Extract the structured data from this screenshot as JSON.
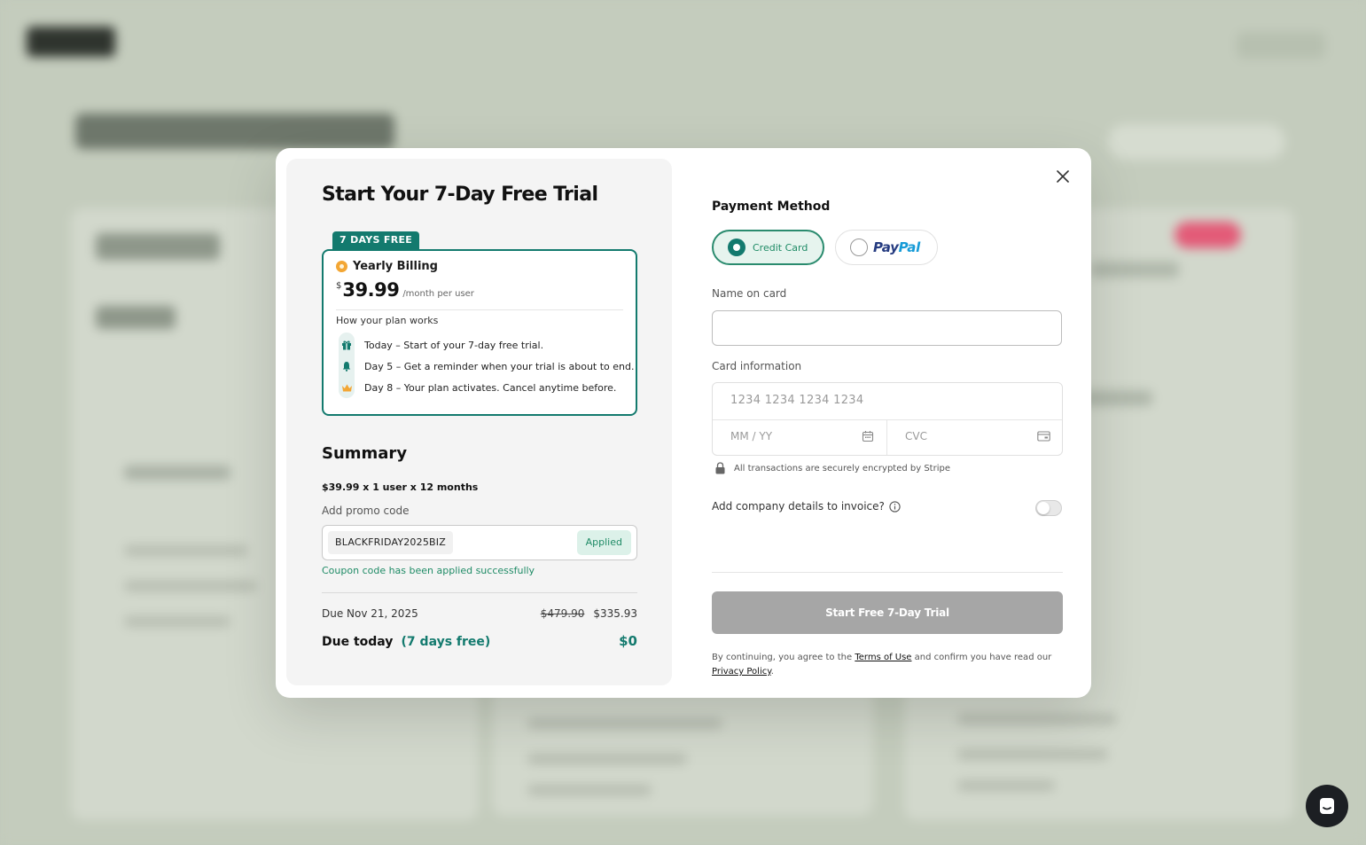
{
  "modal": {
    "title": "Start Your 7-Day Free Trial",
    "plan": {
      "badge": "7 DAYS FREE",
      "billing_label": "Yearly Billing",
      "currency": "$",
      "price": "39.99",
      "period": "/month per user",
      "how_label": "How your plan works",
      "steps": [
        {
          "icon": "gift-icon",
          "text": "Today – Start of your 7-day free trial."
        },
        {
          "icon": "bell-icon",
          "text": "Day 5 – Get a reminder when your trial is about to end."
        },
        {
          "icon": "crown-icon",
          "text": "Day 8 – Your plan activates. Cancel anytime before."
        }
      ]
    },
    "summary": {
      "title": "Summary",
      "line": "$39.99  x 1 user x 12 months",
      "promo_label": "Add promo code",
      "promo_code": "BLACKFRIDAY2025BIZ",
      "applied_label": "Applied",
      "promo_success": "Coupon code has been applied successfully",
      "due_label": "Due Nov 21, 2025",
      "original_price": "$479.90",
      "discounted_price": "$335.93",
      "due_today_label": "Due today",
      "due_today_sub": "(7 days free)",
      "due_today_amount": "$0"
    },
    "payment": {
      "title": "Payment Method",
      "credit_label": "Credit Card",
      "paypal_pay": "Pay",
      "paypal_pal": "Pal",
      "name_label": "Name on card",
      "name_value": "",
      "card_label": "Card information",
      "card_number_placeholder": "1234 1234 1234 1234",
      "expiry_placeholder": "MM / YY",
      "cvc_placeholder": "CVC",
      "secure_text": "All transactions are securely encrypted by Stripe",
      "company_label": "Add company details to invoice?",
      "company_toggle_on": false,
      "submit_label": "Start Free 7-Day Trial",
      "legal_prefix": "By continuing, you agree to the ",
      "terms_link": "Terms of Use",
      "legal_middle": " and confirm you have read our ",
      "privacy_link": "Privacy Policy",
      "legal_suffix": "."
    }
  },
  "colors": {
    "accent": "#137a6e",
    "success": "#1f8b66",
    "disabled_button": "#a6a6a6",
    "backdrop": "#c2cabb"
  }
}
